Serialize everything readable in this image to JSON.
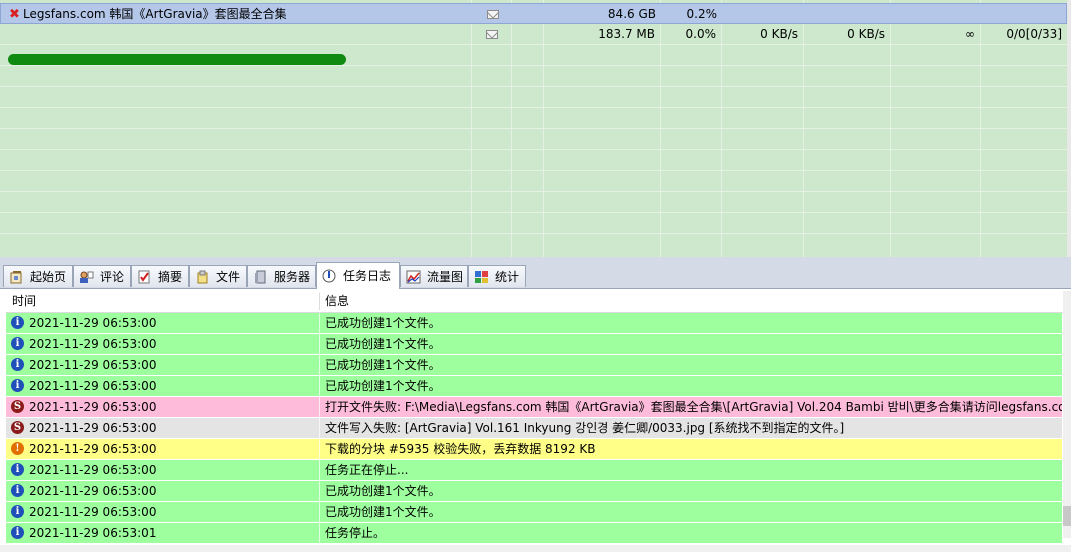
{
  "colors": {
    "info": "#1f4fb8",
    "error": "#8b1a1a",
    "warning": "#e07000",
    "green_row": "#9eff9e",
    "pink_row": "#ffbcda",
    "grey_row": "#e4e4e4",
    "yellow_row": "#ffff88"
  },
  "tasks": [
    {
      "name": "Legsfans.com  韩国《ArtGravia》套图最全合集",
      "icon": "error-x-icon",
      "size": "84.6 GB",
      "progress": "0.2%",
      "down": "",
      "up": "",
      "remaining": "",
      "peers": "",
      "selected": true
    },
    {
      "name": "",
      "icon": "",
      "size": "183.7 MB",
      "progress": "0.0%",
      "down": "0 KB/s",
      "up": "0 KB/s",
      "remaining": "∞",
      "peers": "0/0[0/33]",
      "selected": false
    }
  ],
  "tabs": [
    {
      "label": "起始页",
      "icon": "home-icon"
    },
    {
      "label": "评论",
      "icon": "comment-icon"
    },
    {
      "label": "摘要",
      "icon": "summary-icon"
    },
    {
      "label": "文件",
      "icon": "file-icon"
    },
    {
      "label": "服务器",
      "icon": "server-icon"
    },
    {
      "label": "任务日志",
      "icon": "log-icon",
      "active": true
    },
    {
      "label": "流量图",
      "icon": "chart-icon"
    },
    {
      "label": "统计",
      "icon": "stats-icon"
    }
  ],
  "log": {
    "col_time": "时间",
    "col_msg": "信息",
    "rows": [
      {
        "type": "info",
        "time": "2021-11-29 06:53:00",
        "msg": "已成功创建1个文件。"
      },
      {
        "type": "info",
        "time": "2021-11-29 06:53:00",
        "msg": "已成功创建1个文件。"
      },
      {
        "type": "info",
        "time": "2021-11-29 06:53:00",
        "msg": "已成功创建1个文件。"
      },
      {
        "type": "info",
        "time": "2021-11-29 06:53:00",
        "msg": "已成功创建1个文件。"
      },
      {
        "type": "error",
        "time": "2021-11-29 06:53:00",
        "msg": "打开文件失败: F:\\Media\\Legsfans.com  韩国《ArtGravia》套图最全合集\\[ArtGravia] Vol.204 Bambi 밤비\\更多合集请访问legsfans.com"
      },
      {
        "type": "error2",
        "time": "2021-11-29 06:53:00",
        "msg": "文件写入失败: [ArtGravia] Vol.161 Inkyung 강인경 姜仁卿/0033.jpg [系统找不到指定的文件。]"
      },
      {
        "type": "warning",
        "time": "2021-11-29 06:53:00",
        "msg": "下载的分块 #5935 校验失败，丢弃数据 8192 KB"
      },
      {
        "type": "info",
        "time": "2021-11-29 06:53:00",
        "msg": "任务正在停止..."
      },
      {
        "type": "info",
        "time": "2021-11-29 06:53:00",
        "msg": "已成功创建1个文件。"
      },
      {
        "type": "info",
        "time": "2021-11-29 06:53:00",
        "msg": "已成功创建1个文件。"
      },
      {
        "type": "info",
        "time": "2021-11-29 06:53:01",
        "msg": "任务停止。"
      }
    ]
  }
}
